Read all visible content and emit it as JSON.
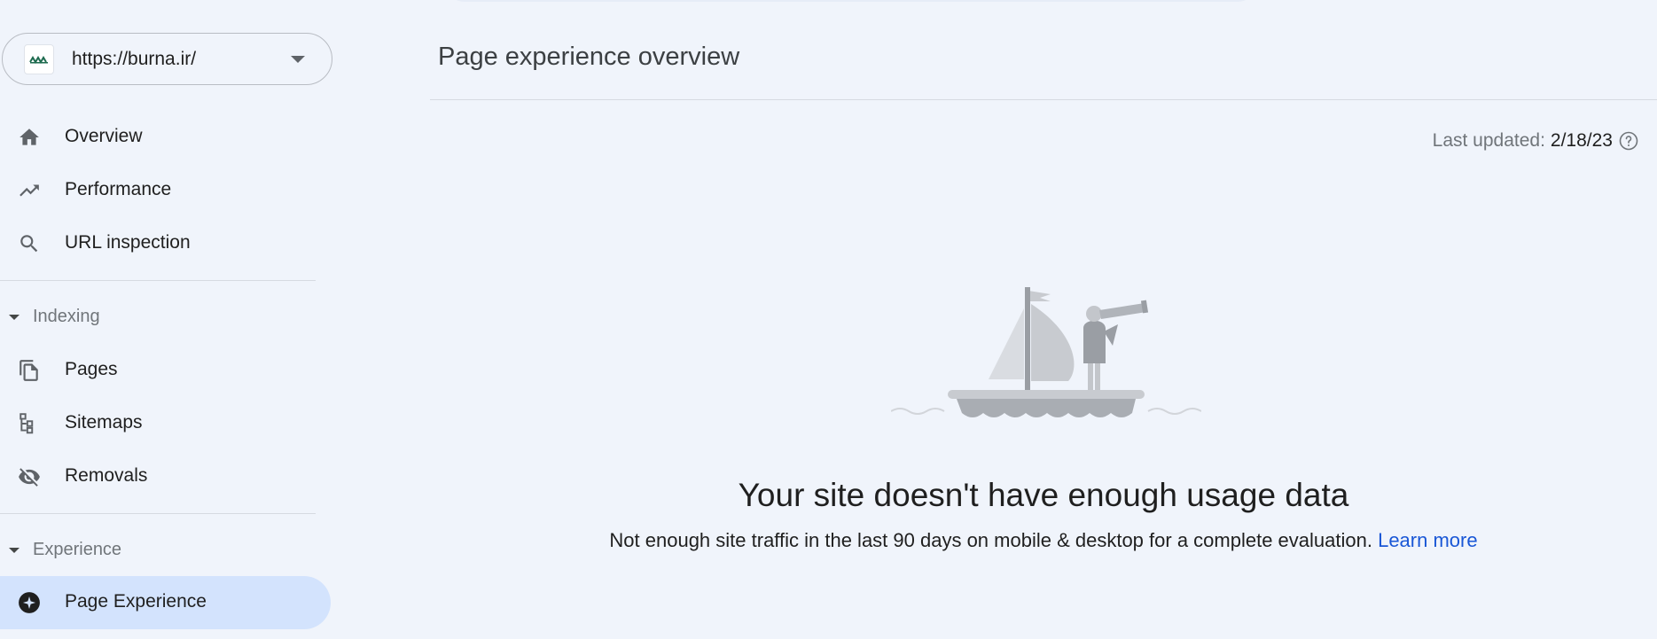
{
  "property": {
    "url": "https://burna.ir/",
    "logo_icon": "site-favicon",
    "caret_icon": "arrow-drop-down-icon"
  },
  "sidebar": {
    "primary_items": [
      {
        "label": "Overview",
        "icon": "home-icon"
      },
      {
        "label": "Performance",
        "icon": "trending-up-icon"
      },
      {
        "label": "URL inspection",
        "icon": "search-icon"
      }
    ],
    "sections": [
      {
        "label": "Indexing",
        "items": [
          {
            "label": "Pages",
            "icon": "pages-icon"
          },
          {
            "label": "Sitemaps",
            "icon": "sitemap-icon"
          },
          {
            "label": "Removals",
            "icon": "visibility-off-icon"
          }
        ]
      },
      {
        "label": "Experience",
        "items": [
          {
            "label": "Page Experience",
            "icon": "page-experience-icon",
            "active": true
          }
        ]
      }
    ]
  },
  "main": {
    "title": "Page experience overview",
    "last_updated": {
      "label": "Last updated:",
      "value": "2/18/23",
      "icon": "help-icon"
    },
    "empty_state": {
      "illustration": "sailboat-telescope-illustration",
      "title": "Your site doesn't have enough usage data",
      "description": "Not enough site traffic in the last 90 days on mobile & desktop for a complete evaluation.",
      "link_label": "Learn more"
    }
  },
  "colors": {
    "background": "#f0f4fb",
    "active_nav": "#d3e3fd",
    "link": "#1a57d6"
  }
}
